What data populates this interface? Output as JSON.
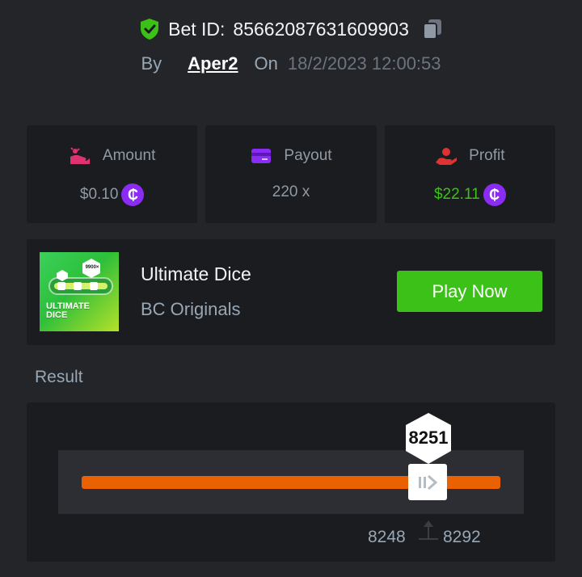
{
  "header": {
    "bet_id_label": "Bet ID:",
    "bet_id": "85662087631609903",
    "by_label": "By",
    "user": "Aper2",
    "on_label": "On",
    "date": "18/2/2023 12:00:53"
  },
  "stats": {
    "amount": {
      "label": "Amount",
      "value": "$0.10"
    },
    "payout": {
      "label": "Payout",
      "value": "220 x"
    },
    "profit": {
      "label": "Profit",
      "value": "$22.11"
    },
    "currency_symbol": "₵"
  },
  "game": {
    "thumb_badge": "9900×",
    "thumb_line1": "ULTIMATE",
    "thumb_line2": "DICE",
    "title": "Ultimate Dice",
    "subtitle": "BC Originals",
    "play_label": "Play Now"
  },
  "result": {
    "label": "Result",
    "roll": "8251",
    "range_low": "8248",
    "range_high": "8292"
  },
  "colors": {
    "background": "#232529",
    "panel": "#1b1c20",
    "accent_green": "#3bc117",
    "track_orange": "#e96100",
    "coin_purple": "#8b2cf5"
  },
  "icons": {
    "verified": "shield-check-icon",
    "copy": "copy-icon",
    "amount": "coins-hand-icon",
    "payout": "card-icon",
    "profit": "profit-hand-icon",
    "slider_handle": "drag-handle-icon",
    "range_pin": "pin-icon"
  }
}
